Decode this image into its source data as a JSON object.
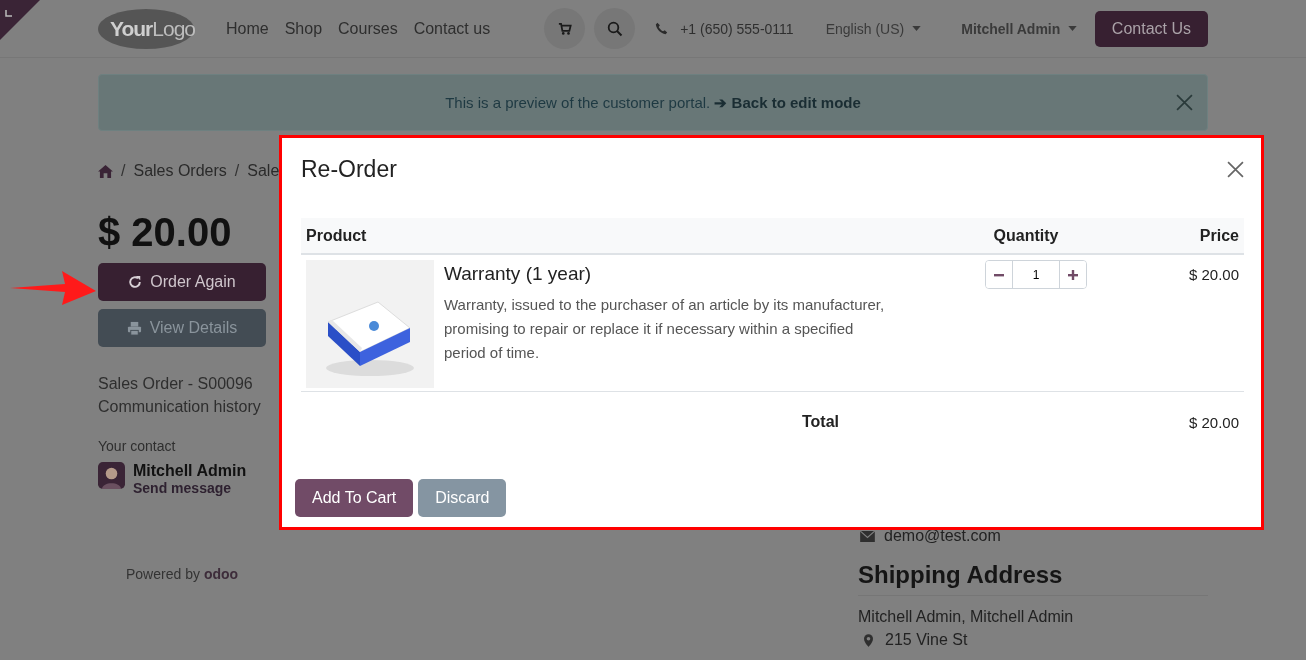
{
  "header": {
    "logo": {
      "bold": "Your",
      "light": "Logo"
    },
    "nav": [
      {
        "label": "Home"
      },
      {
        "label": "Shop"
      },
      {
        "label": "Courses"
      },
      {
        "label": "Contact us"
      }
    ],
    "phone": "+1 (650) 555-0111",
    "language": "English (US)",
    "user": "Mitchell Admin",
    "cta": "Contact Us"
  },
  "banner": {
    "text": "This is a preview of the customer portal.",
    "link": "➔ Back to edit mode"
  },
  "breadcrumb": [
    {
      "separator": "/",
      "label": "Sales Orders"
    },
    {
      "separator": "/",
      "label": "Sale"
    }
  ],
  "sidebar": {
    "amount": "$ 20.00",
    "buttons": [
      {
        "label": "Order Again",
        "kind": "primary"
      },
      {
        "label": "View Details",
        "kind": "secondary"
      }
    ],
    "order_name": "Sales Order - S00096",
    "history": "Communication history",
    "contact_heading": "Your contact",
    "contact_name": "Mitchell Admin",
    "contact_link": "Send message",
    "powered": "Powered by",
    "powered_brand": "odoo"
  },
  "address": {
    "email": "demo@test.com",
    "heading": "Shipping Address",
    "name": "Mitchell Admin, Mitchell Admin",
    "street": "215 Vine St"
  },
  "modal": {
    "title": "Re-Order",
    "columns": [
      "Product",
      "Quantity",
      "Price"
    ],
    "lines": [
      {
        "name": "Warranty (1 year)",
        "description": "Warranty, issued to the purchaser of an article by its manufacturer, promising to repair or replace it if necessary within a specified period of time.",
        "quantity": "1",
        "price": "$ 20.00"
      }
    ],
    "total_label": "Total",
    "total": "$ 20.00",
    "buttons": [
      {
        "label": "Add To Cart",
        "kind": "primary"
      },
      {
        "label": "Discard",
        "kind": "secondary"
      }
    ]
  }
}
